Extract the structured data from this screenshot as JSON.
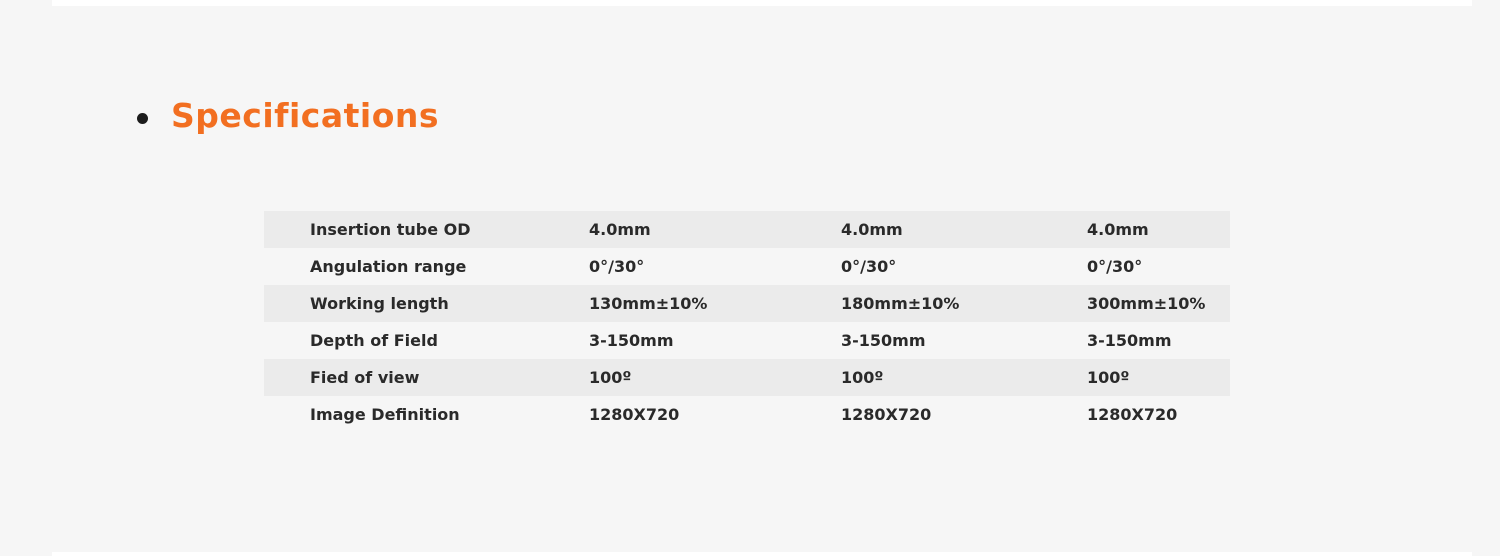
{
  "heading": {
    "title": "Specifications"
  },
  "colors": {
    "accent": "#f26f21",
    "row_shade": "#ebebeb",
    "background": "#f6f6f6"
  },
  "spec_table": {
    "rows": [
      {
        "label": "Insertion tube OD",
        "values": [
          "4.0mm",
          "4.0mm",
          "4.0mm"
        ]
      },
      {
        "label": "Angulation range",
        "values": [
          "0°/30°",
          "0°/30°",
          "0°/30°"
        ]
      },
      {
        "label": "Working length",
        "values": [
          "130mm±10%",
          "180mm±10%",
          "300mm±10%"
        ]
      },
      {
        "label": "Depth of Field",
        "values": [
          "3-150mm",
          "3-150mm",
          "3-150mm"
        ]
      },
      {
        "label": "Fied of view",
        "values": [
          "100º",
          "100º",
          "100º"
        ]
      },
      {
        "label": "Image Definition",
        "values": [
          "1280X720",
          "1280X720",
          "1280X720"
        ]
      }
    ]
  }
}
